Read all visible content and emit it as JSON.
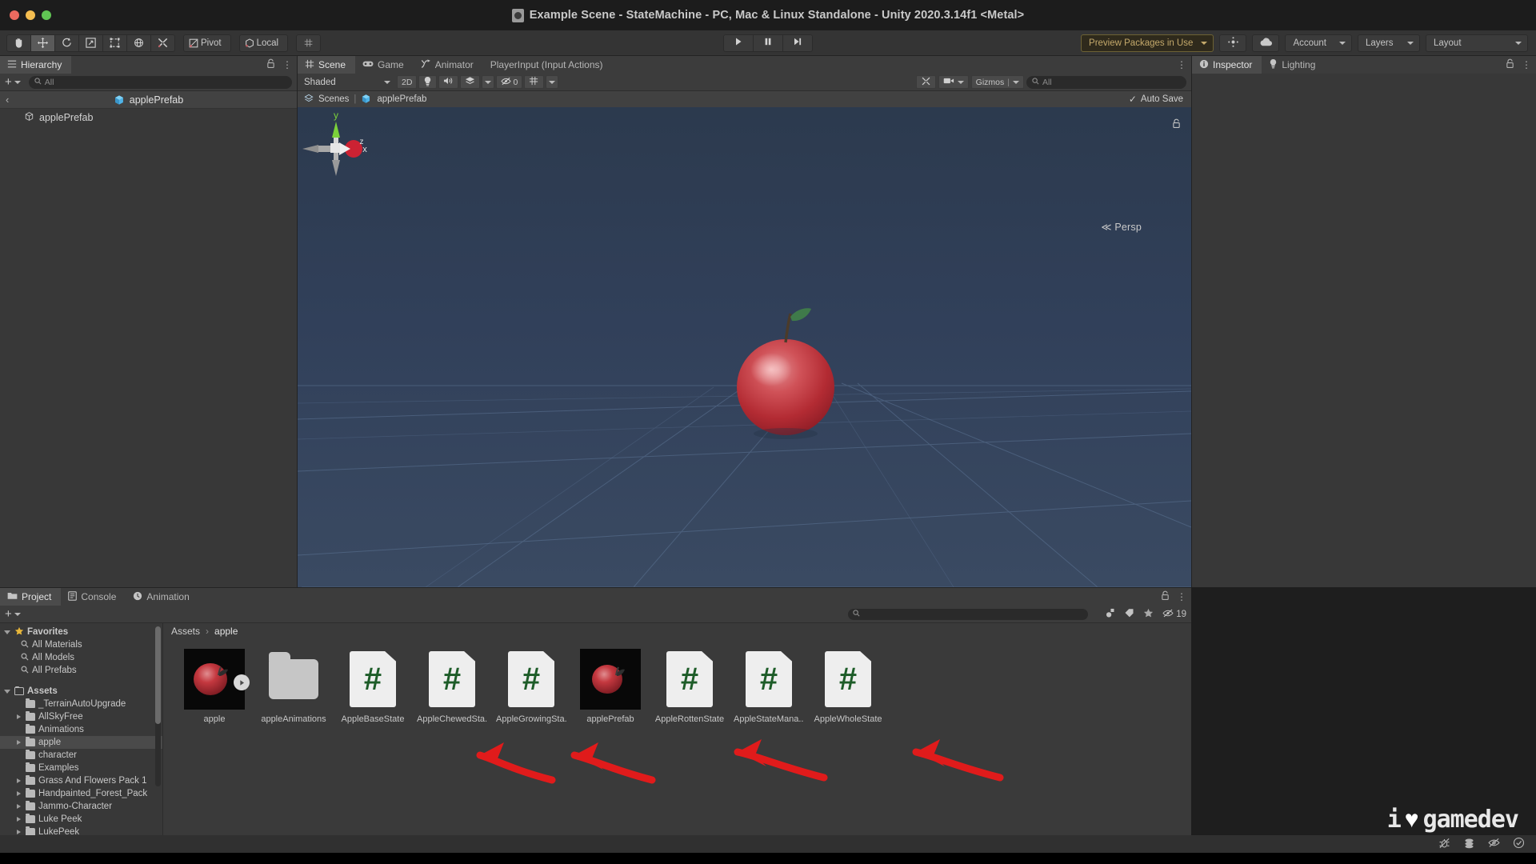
{
  "window": {
    "title": "Example Scene - StateMachine - PC, Mac & Linux Standalone - Unity 2020.3.14f1 <Metal>",
    "title_icon": "unity-app-icon",
    "traffic_lights": [
      "close",
      "minimize",
      "zoom"
    ]
  },
  "toolbar": {
    "tools": [
      {
        "name": "hand-tool",
        "icon": "hand-icon",
        "active": false
      },
      {
        "name": "move-tool",
        "icon": "move-icon",
        "active": true
      },
      {
        "name": "rotate-tool",
        "icon": "rotate-icon",
        "active": false
      },
      {
        "name": "scale-tool",
        "icon": "scale-icon",
        "active": false
      },
      {
        "name": "rect-tool",
        "icon": "rect-transform-icon",
        "active": false
      },
      {
        "name": "transform-tool",
        "icon": "transform-icon",
        "active": false
      },
      {
        "name": "custom-editor-tool",
        "icon": "wrench-screwdriver-icon",
        "active": false
      }
    ],
    "pivot_label": "Pivot",
    "local_label": "Local",
    "grid_snap_icon": "grid-snap-icon",
    "play_controls": [
      {
        "name": "play-button",
        "icon": "play-icon"
      },
      {
        "name": "pause-button",
        "icon": "pause-icon"
      },
      {
        "name": "step-button",
        "icon": "step-icon"
      }
    ],
    "preview_packages_label": "Preview Packages in Use",
    "collab_icon": "services-icon",
    "cloud_icon": "cloud-icon",
    "account_label": "Account",
    "layers_label": "Layers",
    "layout_label": "Layout"
  },
  "hierarchy": {
    "tab_label": "Hierarchy",
    "tab_icon": "hierarchy-icon",
    "lock_icon": "lock-icon",
    "menu_icon": "kebab-menu-icon",
    "add_label": "+",
    "search_placeholder": "All",
    "breadcrumb_label": "applePrefab",
    "rows": [
      {
        "label": "applePrefab",
        "icon": "prefab-icon"
      }
    ]
  },
  "scene": {
    "tabs": [
      {
        "label": "Scene",
        "icon": "scene-icon",
        "active": true
      },
      {
        "label": "Game",
        "icon": "game-icon",
        "active": false
      },
      {
        "label": "Animator",
        "icon": "animator-icon",
        "active": false
      },
      {
        "label": "PlayerInput (Input Actions)",
        "icon": "",
        "active": false
      }
    ],
    "menu_icon": "kebab-menu-icon",
    "draw_mode": "Shaded",
    "toggle_2d": "2D",
    "lighting_icon": "light-bulb-icon",
    "audio_icon": "audio-icon",
    "fx_icon": "fx-icon",
    "hidden_count": "0",
    "grid_icon": "scene-grid-icon",
    "tools_icon": "scene-tools-icon",
    "camera_icon": "scene-camera-icon",
    "gizmos_label": "Gizmos",
    "gizmo_search_placeholder": "All",
    "breadcrumb": [
      "Scenes",
      "applePrefab"
    ],
    "breadcrumb_icon": "scene-small-icon",
    "prefab_icon": "prefab-icon",
    "auto_save_label": "Auto Save",
    "auto_save_checked": true,
    "view_gizmo": {
      "axis_y": "y",
      "axis_x": "x",
      "axis_z": "z",
      "projection_label": "Persp",
      "lock_icon": "gizmo-lock-icon"
    },
    "object": "apple-3d-model"
  },
  "inspector": {
    "tabs": [
      {
        "label": "Inspector",
        "icon": "info-icon",
        "active": true
      },
      {
        "label": "Lighting",
        "icon": "light-bulb-icon",
        "active": false
      }
    ],
    "lock_icon": "lock-icon",
    "menu_icon": "kebab-menu-icon"
  },
  "project": {
    "tabs": [
      {
        "label": "Project",
        "icon": "folder-icon",
        "active": true
      },
      {
        "label": "Console",
        "icon": "console-icon",
        "active": false
      },
      {
        "label": "Animation",
        "icon": "clock-icon",
        "active": false
      }
    ],
    "lock_icon": "lock-icon",
    "menu_icon": "kebab-menu-icon",
    "add_label": "+",
    "search_placeholder": "",
    "filter_icons": [
      "type-filter-icon",
      "label-filter-icon",
      "favorite-star-icon"
    ],
    "hidden_packages_count": "19",
    "hidden_packages_icon": "eye-off-icon",
    "breadcrumb": [
      "Assets",
      "apple"
    ],
    "tree": {
      "favorites": {
        "label": "Favorites",
        "icon": "star-icon",
        "expanded": true,
        "items": [
          {
            "label": "All Materials",
            "icon": "search-icon"
          },
          {
            "label": "All Models",
            "icon": "search-icon"
          },
          {
            "label": "All Prefabs",
            "icon": "search-icon"
          }
        ]
      },
      "assets": {
        "label": "Assets",
        "icon": "folder-open-icon",
        "expanded": true,
        "items": [
          {
            "label": "_TerrainAutoUpgrade",
            "expandable": false,
            "selected": false
          },
          {
            "label": "AllSkyFree",
            "expandable": true,
            "selected": false
          },
          {
            "label": "Animations",
            "expandable": false,
            "selected": false
          },
          {
            "label": "apple",
            "expandable": true,
            "selected": true
          },
          {
            "label": "character",
            "expandable": false,
            "selected": false
          },
          {
            "label": "Examples",
            "expandable": false,
            "selected": false
          },
          {
            "label": "Grass And Flowers Pack 1",
            "expandable": true,
            "selected": false
          },
          {
            "label": "Handpainted_Forest_Pack",
            "expandable": true,
            "selected": false
          },
          {
            "label": "Jammo-Character",
            "expandable": true,
            "selected": false
          },
          {
            "label": "Luke Peek",
            "expandable": true,
            "selected": false
          },
          {
            "label": "LukePeek",
            "expandable": true,
            "selected": false
          }
        ]
      }
    },
    "assets": [
      {
        "label": "apple",
        "kind": "model-preview",
        "badge": "play-badge"
      },
      {
        "label": "appleAnimations",
        "kind": "folder",
        "badge": ""
      },
      {
        "label": "AppleBaseState",
        "kind": "csharp-script",
        "badge": ""
      },
      {
        "label": "AppleChewedSta...",
        "kind": "csharp-script",
        "badge": ""
      },
      {
        "label": "AppleGrowingSta...",
        "kind": "csharp-script",
        "badge": ""
      },
      {
        "label": "applePrefab",
        "kind": "prefab-preview",
        "badge": ""
      },
      {
        "label": "AppleRottenState",
        "kind": "csharp-script",
        "badge": ""
      },
      {
        "label": "AppleStateMana...",
        "kind": "csharp-script",
        "badge": ""
      },
      {
        "label": "AppleWholeState",
        "kind": "csharp-script",
        "badge": ""
      }
    ],
    "csharp_glyph": "#"
  },
  "annotations": {
    "arrow_color": "#e01b1b",
    "arrows": [
      {
        "name": "arrow-to-apple-chewed-state"
      },
      {
        "name": "arrow-to-apple-growing-state"
      },
      {
        "name": "arrow-to-apple-rotten-state"
      },
      {
        "name": "arrow-to-apple-whole-state"
      }
    ]
  },
  "watermark": {
    "prefix": "i",
    "heart": "♥",
    "text": "gamedev"
  },
  "statusbar": {
    "icons": [
      "bug-icon",
      "layers-stack-icon",
      "eye-off-icon",
      "check-circle-icon"
    ]
  },
  "colors": {
    "accent_amber": "#c4a96b",
    "panel_bg": "#383838",
    "toolbar_bg": "#343434",
    "scene_bg": "#31405a",
    "script_green": "#1d5c28",
    "apple_red": "#c4313a"
  }
}
